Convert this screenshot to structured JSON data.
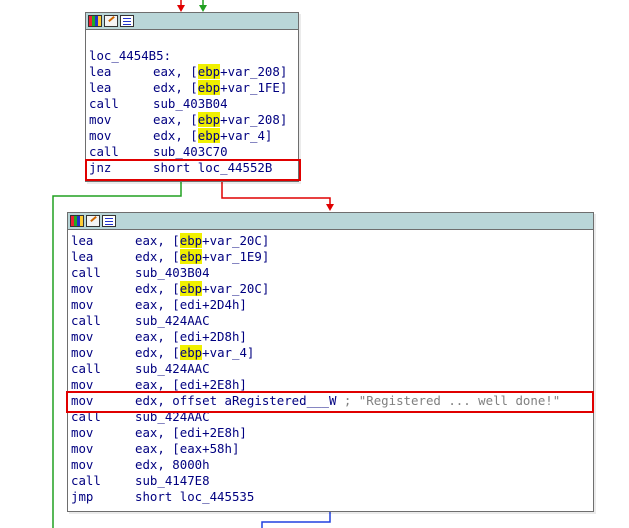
{
  "colors": {
    "background": "#ffffff",
    "block_border": "#6e6e6e",
    "titlebar": "#b9d6d8",
    "text": "#000080",
    "register_highlight": "#f0f000",
    "highlight_box": "#e00000",
    "edge_false": "#e00000",
    "edge_true": "#20a020",
    "edge_normal": "#2040e0"
  },
  "block1": {
    "title_icons": [
      "graph-icon",
      "edit-icon",
      "list-icon"
    ],
    "label": "loc_4454B5:",
    "lines": [
      {
        "m": "lea",
        "a": "eax, [",
        "r": "ebp",
        "b": "+var_208]"
      },
      {
        "m": "lea",
        "a": "edx, [",
        "r": "ebp",
        "b": "+var_1FE]"
      },
      {
        "m": "call",
        "a": "sub_403B04",
        "r": "",
        "b": ""
      },
      {
        "m": "mov",
        "a": "eax, [",
        "r": "ebp",
        "b": "+var_208]"
      },
      {
        "m": "mov",
        "a": "edx, [",
        "r": "ebp",
        "b": "+var_4]"
      },
      {
        "m": "call",
        "a": "sub_403C70",
        "r": "",
        "b": ""
      },
      {
        "m": "jnz",
        "a": "short loc_44552B",
        "r": "",
        "b": ""
      }
    ]
  },
  "block2": {
    "title_icons": [
      "graph-icon",
      "edit-icon",
      "list-icon"
    ],
    "lines": [
      {
        "m": "lea",
        "a": "eax, [",
        "r": "ebp",
        "b": "+var_20C]",
        "c": ""
      },
      {
        "m": "lea",
        "a": "edx, [",
        "r": "ebp",
        "b": "+var_1E9]",
        "c": ""
      },
      {
        "m": "call",
        "a": "sub_403B04",
        "r": "",
        "b": "",
        "c": ""
      },
      {
        "m": "mov",
        "a": "edx, [",
        "r": "ebp",
        "b": "+var_20C]",
        "c": ""
      },
      {
        "m": "mov",
        "a": "eax, [edi+2D4h]",
        "r": "",
        "b": "",
        "c": ""
      },
      {
        "m": "call",
        "a": "sub_424AAC",
        "r": "",
        "b": "",
        "c": ""
      },
      {
        "m": "mov",
        "a": "eax, [edi+2D8h]",
        "r": "",
        "b": "",
        "c": ""
      },
      {
        "m": "mov",
        "a": "edx, [",
        "r": "ebp",
        "b": "+var_4]",
        "c": ""
      },
      {
        "m": "call",
        "a": "sub_424AAC",
        "r": "",
        "b": "",
        "c": ""
      },
      {
        "m": "mov",
        "a": "eax, [edi+2E8h]",
        "r": "",
        "b": "",
        "c": ""
      },
      {
        "m": "mov",
        "a": "edx, offset aRegistered___W",
        "r": "",
        "b": "",
        "c": " ; \"Registered ... well done!\""
      },
      {
        "m": "call",
        "a": "sub_424AAC",
        "r": "",
        "b": "",
        "c": ""
      },
      {
        "m": "mov",
        "a": "eax, [edi+2E8h]",
        "r": "",
        "b": "",
        "c": ""
      },
      {
        "m": "mov",
        "a": "eax, [eax+58h]",
        "r": "",
        "b": "",
        "c": ""
      },
      {
        "m": "mov",
        "a": "edx, 8000h",
        "r": "",
        "b": "",
        "c": ""
      },
      {
        "m": "call",
        "a": "sub_4147E8",
        "r": "",
        "b": "",
        "c": ""
      },
      {
        "m": "jmp",
        "a": "short loc_445535",
        "r": "",
        "b": "",
        "c": ""
      }
    ]
  }
}
